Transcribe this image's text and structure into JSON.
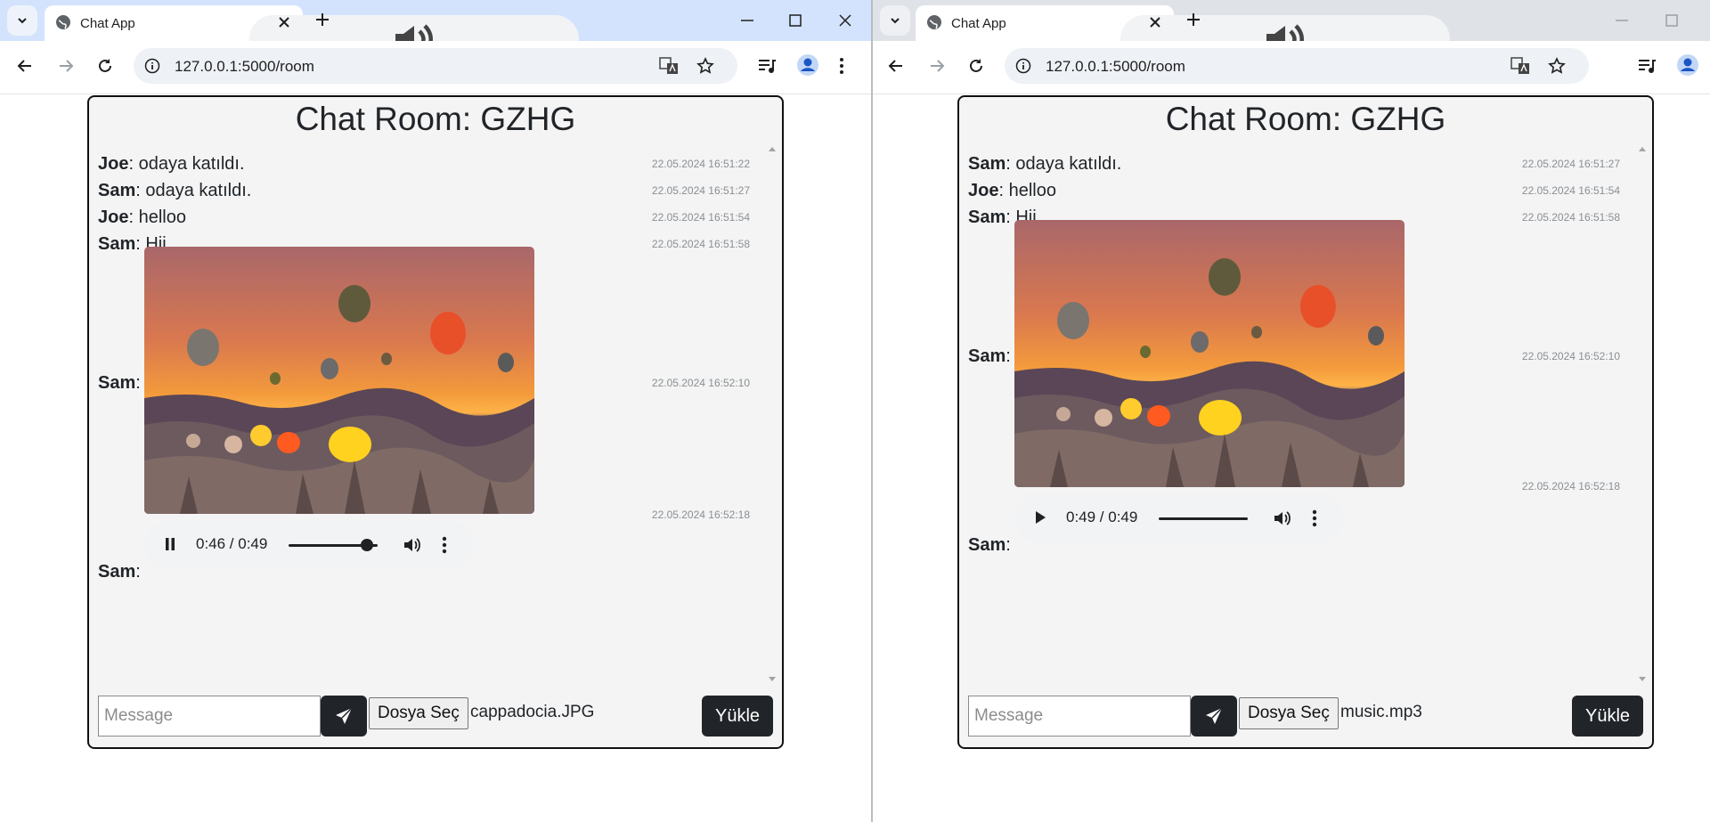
{
  "windows": [
    {
      "tab_title": "Chat App",
      "url": "127.0.0.1:5000/room",
      "room_title": "Chat Room: GZHG",
      "messages": [
        {
          "user": "Joe",
          "text": ": odaya katıldı.",
          "time": "22.05.2024 16:51:22"
        },
        {
          "user": "Sam",
          "text": ": odaya katıldı.",
          "time": "22.05.2024 16:51:27"
        },
        {
          "user": "Joe",
          "text": ": helloo",
          "time": "22.05.2024 16:51:54"
        },
        {
          "user": "Sam",
          "text": ": Hii",
          "time": "22.05.2024 16:51:58"
        },
        {
          "user": "Sam",
          "text": ":",
          "time": "22.05.2024 16:52:10"
        },
        {
          "user": "Sam",
          "text": ":",
          "time": "22.05.2024 16:52:18"
        }
      ],
      "audio": {
        "time": "0:46 / 0:49",
        "state": "pause-icon",
        "progress": 0.88
      },
      "composer": {
        "placeholder": "Message",
        "file_button": "Dosya Seç",
        "file_name": "cappadocia.JPG",
        "upload": "Yükle"
      }
    },
    {
      "tab_title": "Chat App",
      "url": "127.0.0.1:5000/room",
      "room_title": "Chat Room: GZHG",
      "messages": [
        {
          "user": "Sam",
          "text": ": odaya katıldı.",
          "time": "22.05.2024 16:51:27"
        },
        {
          "user": "Joe",
          "text": ": helloo",
          "time": "22.05.2024 16:51:54"
        },
        {
          "user": "Sam",
          "text": ": Hii",
          "time": "22.05.2024 16:51:58"
        },
        {
          "user": "Sam",
          "text": ":",
          "time": "22.05.2024 16:52:10"
        },
        {
          "user": "Sam",
          "text": ":",
          "time": "22.05.2024 16:52:18"
        }
      ],
      "audio": {
        "time": "0:49 / 0:49",
        "state": "play-icon",
        "progress": 1.0
      },
      "composer": {
        "placeholder": "Message",
        "file_button": "Dosya Seç",
        "file_name": "music.mp3",
        "upload": "Yükle"
      }
    }
  ]
}
